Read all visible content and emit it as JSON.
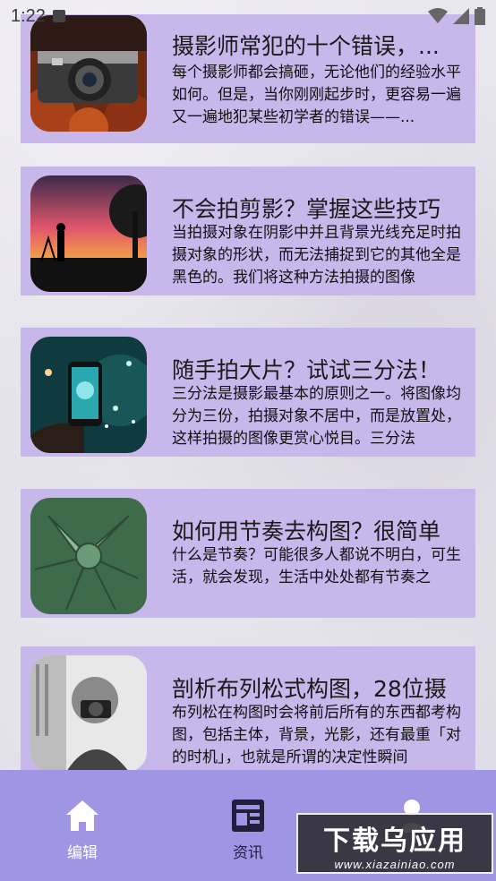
{
  "status_bar": {
    "time": "1:22"
  },
  "articles": [
    {
      "title": "摄影师常犯的十个错误，...",
      "body": "每个摄影师都会搞砸，无论他们的经验水平如何。但是，当你刚刚起步时，更容易一遍又一遍地犯某些初学者的错误——...",
      "thumb": "camera-on-leaves"
    },
    {
      "title": "不会拍剪影？掌握这些技巧",
      "body": "当拍摄对象在阴影中并且背景光线充足时拍摄对象的形状，而无法捕捉到它的其他全是黑色的。我们将这种方法拍摄的图像",
      "thumb": "silhouette-sunset"
    },
    {
      "title": "随手拍大片？试试三分法！",
      "body": "三分法是摄影最基本的原则之一。将图像均分为三份，拍摄对象不居中，而是放置处，这样拍摄的图像更赏心悦目。三分法",
      "thumb": "phone-fireworks"
    },
    {
      "title": "如何用节奏去构图？很简单",
      "body": "什么是节奏？可能很多人都说不明白，可生活，就会发现，生活中处处都有节奏之",
      "thumb": "succulent-spiral"
    },
    {
      "title": "剖析布列松式构图，28位摄",
      "body": "布列松在构图时会将前后所有的东西都考构图，包括主体，背景，光影，还有最重「对的时机」，也就是所谓的决定性瞬间",
      "thumb": "photographer-portrait"
    }
  ],
  "bottom_nav": {
    "items": [
      {
        "label": "编辑",
        "icon": "home-icon"
      },
      {
        "label": "资讯",
        "icon": "news-icon"
      },
      {
        "label": "",
        "icon": "profile-icon"
      }
    ],
    "active_color": "#1f1f3d",
    "background": "#9f95e5"
  },
  "watermark": {
    "main": "下载乌应用",
    "sub": "www.xiazainiao.com"
  }
}
